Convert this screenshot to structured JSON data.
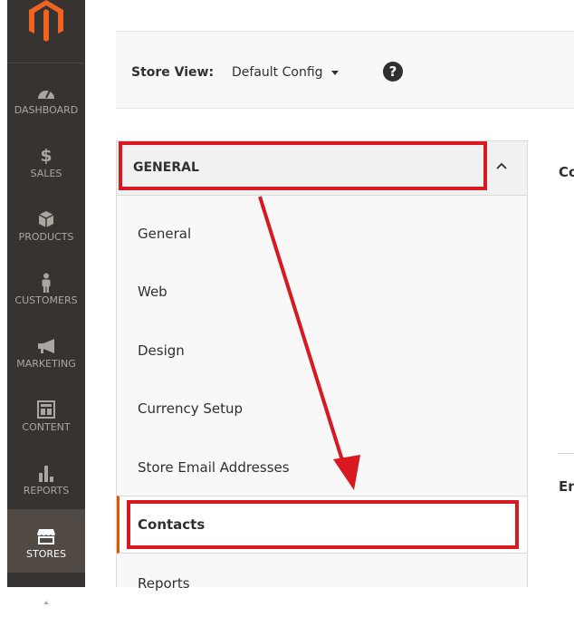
{
  "nav": {
    "logo": "magento-logo",
    "items": [
      {
        "label": "DASHBOARD",
        "icon": "dashboard-icon"
      },
      {
        "label": "SALES",
        "icon": "dollar-icon"
      },
      {
        "label": "PRODUCTS",
        "icon": "cube-icon"
      },
      {
        "label": "CUSTOMERS",
        "icon": "person-icon"
      },
      {
        "label": "MARKETING",
        "icon": "megaphone-icon"
      },
      {
        "label": "CONTENT",
        "icon": "layout-icon"
      },
      {
        "label": "REPORTS",
        "icon": "bar-chart-icon"
      },
      {
        "label": "STORES",
        "icon": "store-icon"
      }
    ],
    "active": "STORES"
  },
  "store_bar": {
    "label": "Store View:",
    "selected": "Default Config",
    "help": "?"
  },
  "config": {
    "section_title": "GENERAL",
    "tabs": [
      {
        "label": "General"
      },
      {
        "label": "Web"
      },
      {
        "label": "Design"
      },
      {
        "label": "Currency Setup"
      },
      {
        "label": "Store Email Addresses"
      },
      {
        "label": "Contacts"
      },
      {
        "label": "Reports"
      }
    ],
    "active_tab": "Contacts"
  },
  "content_peek": {
    "top": "Co",
    "bottom": "En"
  },
  "colors": {
    "nav_bg": "#373330",
    "nav_active": "#514943",
    "annotation": "#d9181f",
    "accent": "#eb5202",
    "logo": "#f26322"
  }
}
